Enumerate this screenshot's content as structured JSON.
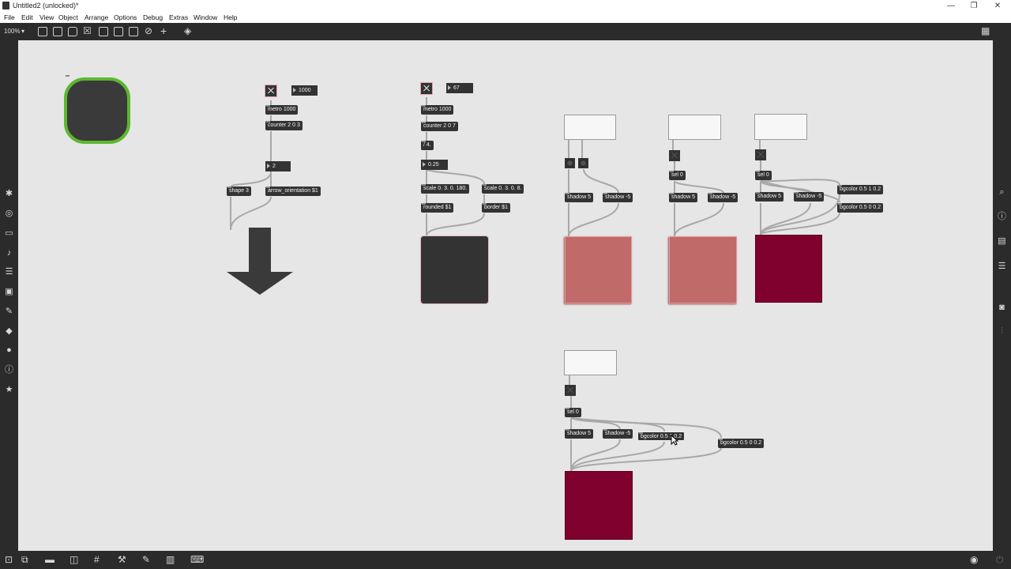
{
  "window": {
    "title": "Untitled2 (unlocked)*",
    "controls": {
      "minimize": "—",
      "maximize": "❐",
      "close": "✕"
    }
  },
  "menu": {
    "items": [
      "File",
      "Edit",
      "View",
      "Object",
      "Arrange",
      "Options",
      "Debug",
      "Extras",
      "Window",
      "Help"
    ]
  },
  "toolbar": {
    "zoom": "100%",
    "zoom_arrow": "▾",
    "icons": [
      "presentation-icon",
      "patcher-icon",
      "comment-icon",
      "clear-icon",
      "object-icon",
      "inspector-icon",
      "align-icon",
      "help-icon",
      "add-icon",
      "paint-icon",
      "grid-icon"
    ]
  },
  "left_sidebar": {
    "icons": [
      "object-palette-icon",
      "circle-icon",
      "bar-icon",
      "note-icon",
      "list-icon",
      "image-icon",
      "pencil-icon",
      "cube-icon",
      "vst-icon",
      "info-icon",
      "star-icon"
    ]
  },
  "right_sidebar": {
    "icons": [
      "search-icon",
      "info-icon",
      "book-icon",
      "list-icon",
      "snapshot-icon",
      "mixer-icon"
    ]
  },
  "bottom_bar": {
    "icons": [
      "lock-icon",
      "edit-icon",
      "comment-icon",
      "stack-icon",
      "grid-icon",
      "tool-icon",
      "wrench-icon",
      "piano-icon",
      "keyboard-icon",
      "play-icon",
      "power-icon"
    ]
  },
  "patch": {
    "group1": {
      "metro": "metro 1000",
      "counter": "counter 2 0 3",
      "number_top": "1000",
      "number_mid": "2",
      "shape": "shape 3",
      "arrow": "arrow_orientation $1"
    },
    "group2": {
      "number_top": "67",
      "metro": "metro 1000",
      "counter": "counter 2 0 7",
      "divide": "/ 4.",
      "flonum": "0.25",
      "scale1": "scale 0. 3. 0. 180.",
      "scale2": "scale 0. 3. 0. 8.",
      "rounded": "rounded $1",
      "border": "border $1"
    },
    "group3": {
      "shadow_pos": "shadow 5",
      "shadow_neg": "shadow -5"
    },
    "group4": {
      "sel": "sel 0",
      "shadow_pos": "shadow 5",
      "shadow_neg": "shadow -5"
    },
    "group5": {
      "sel": "sel 0",
      "shadow_pos": "shadow 5",
      "shadow_neg": "shadow -5",
      "bg_on": "bgcolor 0.5 1 0.2",
      "bg_off": "bgcolor 0.5 0 0.2"
    },
    "group6": {
      "sel": "sel 0",
      "shadow_pos": "shadow 5",
      "shadow_neg": "shadow -5",
      "bg_on": "bgcolor 0.5 1 0.2",
      "bg_off": "bgcolor 0.5 0 0.2"
    }
  },
  "colors": {
    "canvas": "#e6e6e6",
    "object": "#333333",
    "pink_panel": "#c06a6a",
    "maroon_panel": "#80002e",
    "green_outline": "#5cb82e"
  }
}
